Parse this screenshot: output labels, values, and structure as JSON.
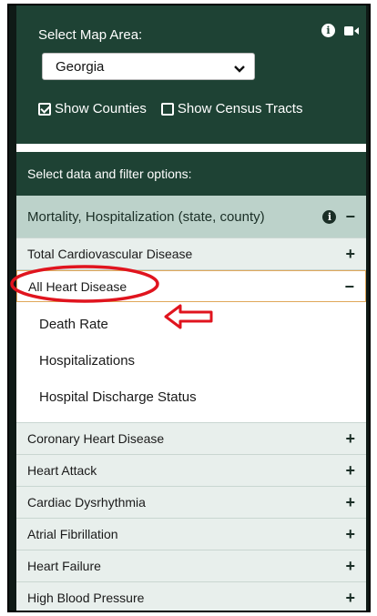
{
  "map_area": {
    "label": "Select Map Area:",
    "selected": "Georgia",
    "show_counties_label": "Show Counties",
    "show_counties_checked": true,
    "show_census_label": "Show Census Tracts",
    "show_census_checked": false
  },
  "filter": {
    "title": "Select data and filter options:",
    "group_label": "Mortality, Hospitalization (state, county)",
    "items": [
      {
        "label": "Total Cardiovascular Disease",
        "expanded": false
      },
      {
        "label": "All Heart Disease",
        "expanded": true,
        "children": [
          "Death Rate",
          "Hospitalizations",
          "Hospital Discharge Status"
        ]
      },
      {
        "label": "Coronary Heart Disease",
        "expanded": false
      },
      {
        "label": "Heart Attack",
        "expanded": false
      },
      {
        "label": "Cardiac Dysrhythmia",
        "expanded": false
      },
      {
        "label": "Atrial Fibrillation",
        "expanded": false
      },
      {
        "label": "Heart Failure",
        "expanded": false
      },
      {
        "label": "High Blood Pressure",
        "expanded": false
      }
    ]
  },
  "colors": {
    "header_green": "#1e4234",
    "group_bg": "#bcd2ca",
    "item_bg": "#e8efec",
    "annotation_red": "#e0141e"
  },
  "icons": {
    "expand": "plus-icon",
    "collapse": "minus-icon",
    "info": "info-icon",
    "video": "video-icon"
  }
}
